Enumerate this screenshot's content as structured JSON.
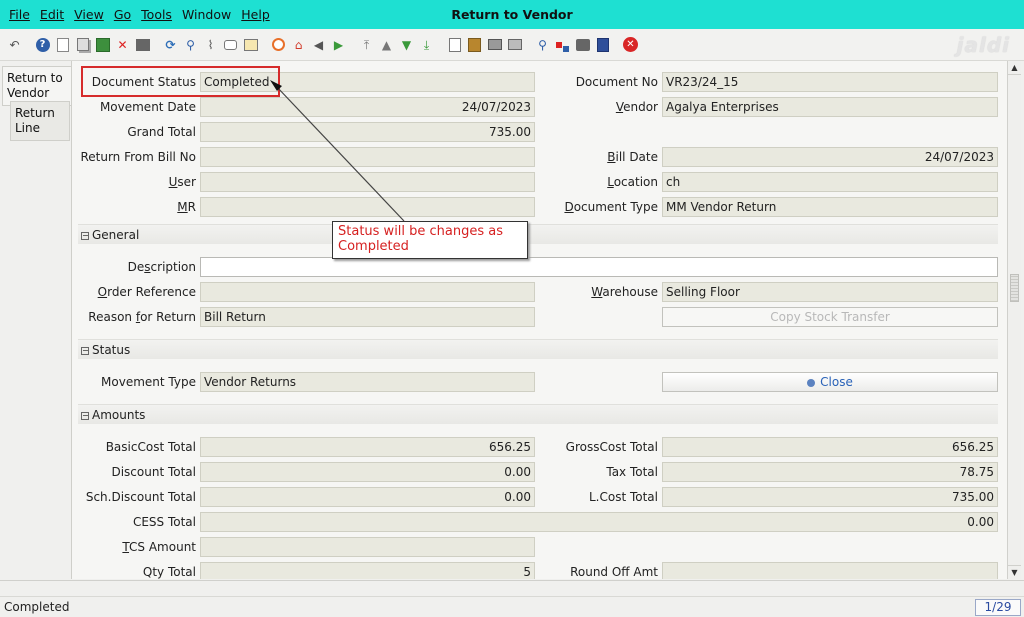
{
  "menu": {
    "items": [
      {
        "label": "File"
      },
      {
        "label": "Edit"
      },
      {
        "label": "View"
      },
      {
        "label": "Go"
      },
      {
        "label": "Tools"
      },
      {
        "label": "Window"
      },
      {
        "label": "Help"
      }
    ]
  },
  "window": {
    "title": "Return to Vendor",
    "logo": "jaldi"
  },
  "toolbar": {
    "icons": [
      "undo-icon",
      "help-icon",
      "new-icon",
      "copy-icon",
      "save-icon",
      "delete-icon",
      "print-preview-icon",
      "refresh-icon",
      "find-icon",
      "attachment-icon",
      "chat-icon",
      "history-icon",
      "zoom-icon",
      "home-icon",
      "previous-icon",
      "next-icon",
      "first-icon",
      "up-icon",
      "down-icon",
      "last-icon",
      "report-icon",
      "archive-icon",
      "print-icon",
      "print-setup-icon",
      "zoom-across-icon",
      "workflow-icon",
      "request-icon",
      "product-info-icon",
      "end-icon"
    ]
  },
  "tabs": [
    {
      "label": "Return to Vendor"
    },
    {
      "label": "Return Line"
    }
  ],
  "header": {
    "document_status": {
      "label": "Document Status",
      "value": "Completed"
    },
    "document_no": {
      "label": "Document No",
      "value": "VR23/24_15"
    },
    "movement_date": {
      "label": "Movement Date",
      "value": "24/07/2023"
    },
    "vendor": {
      "label": "Vendor",
      "value": "Agalya Enterprises"
    },
    "grand_total": {
      "label": "Grand Total",
      "value": "735.00"
    },
    "return_from_bill_no": {
      "label": "Return From Bill No",
      "value": ""
    },
    "bill_date": {
      "label": "Bill Date",
      "value": "24/07/2023"
    },
    "user": {
      "label": "User",
      "value": ""
    },
    "location": {
      "label": "Location",
      "value": "ch"
    },
    "mr": {
      "label": "MR",
      "value": ""
    },
    "document_type": {
      "label": "Document Type",
      "value": "MM Vendor Return"
    }
  },
  "general": {
    "section_label": "General",
    "description": {
      "label": "Description",
      "value": ""
    },
    "order_reference": {
      "label": "Order Reference",
      "value": ""
    },
    "warehouse": {
      "label": "Warehouse",
      "value": "Selling Floor"
    },
    "reason_for_return": {
      "label": "Reason for Return",
      "value": "Bill Return"
    },
    "copy_stock_transfer": "Copy Stock Transfer"
  },
  "status": {
    "section_label": "Status",
    "movement_type": {
      "label": "Movement Type",
      "value": "Vendor Returns"
    },
    "close_button": "Close"
  },
  "amounts": {
    "section_label": "Amounts",
    "basic_cost_total": {
      "label": "BasicCost Total",
      "value": "656.25"
    },
    "gross_cost_total": {
      "label": "GrossCost Total",
      "value": "656.25"
    },
    "discount_total": {
      "label": "Discount Total",
      "value": "0.00"
    },
    "tax_total": {
      "label": "Tax Total",
      "value": "78.75"
    },
    "sch_discount_total": {
      "label": "Sch.Discount Total",
      "value": "0.00"
    },
    "l_cost_total": {
      "label": "L.Cost Total",
      "value": "735.00"
    },
    "cess_total": {
      "label": "CESS Total",
      "value": "0.00"
    },
    "tcs_amount": {
      "label": "TCS Amount",
      "value": ""
    },
    "qty_total": {
      "label": "Qty Total",
      "value": "5"
    },
    "round_off_amt": {
      "label": "Round Off Amt",
      "value": ""
    }
  },
  "annotation": {
    "text": "Status will be changes as Completed",
    "color": "#d62121"
  },
  "statusbar": {
    "text": "Completed",
    "record": "1/29"
  }
}
